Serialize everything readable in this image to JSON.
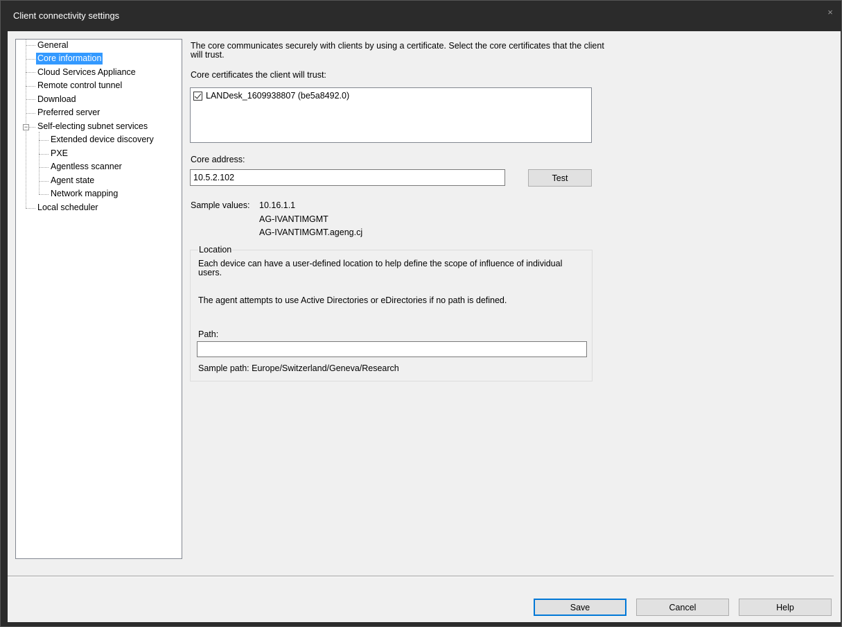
{
  "window": {
    "title": "Client connectivity settings",
    "close_glyph": "×"
  },
  "tree": {
    "items": [
      {
        "label": "General"
      },
      {
        "label": "Core information"
      },
      {
        "label": "Cloud Services Appliance"
      },
      {
        "label": "Remote control tunnel"
      },
      {
        "label": "Download"
      },
      {
        "label": "Preferred server"
      },
      {
        "label": "Self-electing subnet services"
      },
      {
        "label": "Extended device discovery"
      },
      {
        "label": "PXE"
      },
      {
        "label": "Agentless scanner"
      },
      {
        "label": "Agent state"
      },
      {
        "label": "Network mapping"
      },
      {
        "label": "Local scheduler"
      }
    ],
    "selected": "Core information",
    "expander_glyph": "−"
  },
  "main": {
    "description": "The core communicates securely with clients by using a certificate. Select the core certificates that the client will trust.",
    "cert_label": "Core certificates the client will trust:",
    "certificates": [
      {
        "label": "LANDesk_1609938807 (be5a8492.0)",
        "checked": true
      }
    ],
    "core_address_label": "Core address:",
    "core_address_value": "10.5.2.102",
    "test_button": "Test",
    "sample_values_label": "Sample values:",
    "sample_values": [
      "10.16.1.1",
      "AG-IVANTIMGMT",
      "AG-IVANTIMGMT.ageng.cj"
    ]
  },
  "location": {
    "legend": "Location",
    "text1": "Each device can have a user-defined location to help define the scope of influence of individual users.",
    "text2": "The agent attempts to use Active Directories or eDirectories if no path is defined.",
    "path_label": "Path:",
    "path_value": "",
    "sample_path": "Sample path: Europe/Switzerland/Geneva/Research"
  },
  "buttons": {
    "save": "Save",
    "cancel": "Cancel",
    "help": "Help"
  },
  "colors": {
    "selection": "#3399ff",
    "titlebar": "#2b2b2b",
    "client_bg": "#f0f0f0",
    "default_button_border": "#0078d7"
  },
  "icons": {
    "close": "close-icon",
    "checkbox": "checkmark-icon",
    "expander": "collapse-minus-icon"
  }
}
